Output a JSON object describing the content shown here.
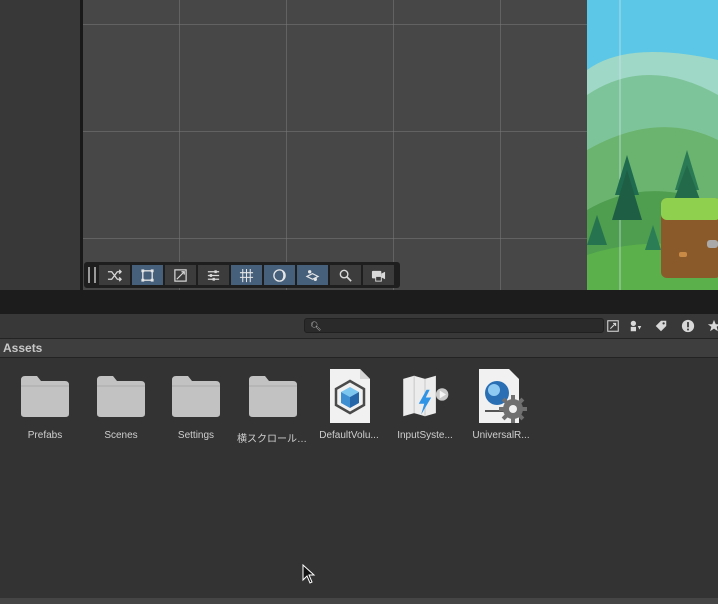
{
  "overlay_toolbar": {
    "buttons": [
      {
        "icon": "shuffle-icon",
        "active": false
      },
      {
        "icon": "rect-tool-icon",
        "active": true
      },
      {
        "icon": "transform-gizmo-icon",
        "active": false
      },
      {
        "icon": "sliders-icon",
        "active": false
      },
      {
        "icon": "snap-grid-icon",
        "active": true
      },
      {
        "icon": "shading-mode-icon",
        "active": true
      },
      {
        "icon": "gizmos-icon",
        "active": true
      },
      {
        "icon": "search-icon",
        "active": false
      },
      {
        "icon": "camera-icon",
        "active": false
      }
    ]
  },
  "project": {
    "search": {
      "placeholder": "",
      "icon": "search-icon"
    },
    "toolbar_icons": [
      "scene-visibility-icon",
      "filter-by-type-icon",
      "filter-by-label-icon",
      "warning-count-icon",
      "favorites-star-icon"
    ],
    "breadcrumb": "Assets",
    "assets": [
      {
        "label": "Prefabs",
        "icon": "folder-icon"
      },
      {
        "label": "Scenes",
        "icon": "folder-icon"
      },
      {
        "label": "Settings",
        "icon": "folder-icon"
      },
      {
        "label": "横スクロールア...",
        "icon": "folder-icon"
      },
      {
        "label": "DefaultVolu...",
        "icon": "volume-profile-icon"
      },
      {
        "label": "InputSyste...",
        "icon": "input-actions-icon"
      },
      {
        "label": "UniversalR...",
        "icon": "render-pipeline-asset-icon"
      }
    ]
  },
  "colors": {
    "accent": "#46607c",
    "panel": "#383838",
    "background": "#282828"
  }
}
